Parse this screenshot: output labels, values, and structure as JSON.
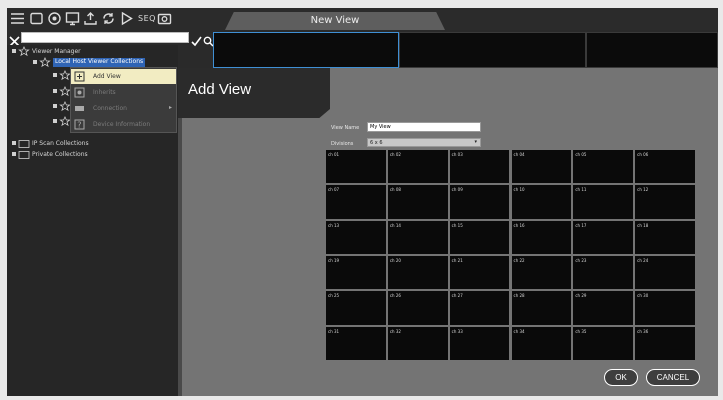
{
  "toolbar": {
    "icons": [
      "menu-icon",
      "window-icon",
      "settings-icon",
      "monitor-icon",
      "upload-icon",
      "sync-icon",
      "play-icon",
      "seq-icon",
      "camera-icon"
    ],
    "seq_label": "SEQ"
  },
  "tab": {
    "label": "New View"
  },
  "search": {
    "value": ""
  },
  "tree": {
    "viewer_manager": "Viewer Manager",
    "selected_collection": "Local Host Viewer Collections",
    "ip_scan": "IP Scan Collections",
    "private": "Private Collections"
  },
  "context_menu": {
    "items": [
      {
        "label": "Add View",
        "icon": "add-view-icon"
      },
      {
        "label": "Inherits",
        "icon": "inherits-icon"
      },
      {
        "label": "Connection",
        "icon": "connection-icon"
      },
      {
        "label": "Device Information",
        "icon": "question-icon"
      }
    ]
  },
  "dialog": {
    "title": "Add View",
    "name_label": "View Name",
    "name_value": "My View",
    "layout_label": "Divisions",
    "layout_value": "6 x 6",
    "ok_label": "OK",
    "cancel_label": "CANCEL"
  },
  "grid": {
    "cells": [
      "ch 01",
      "ch 02",
      "ch 03",
      "ch 04",
      "ch 05",
      "ch 06",
      "ch 07",
      "ch 08",
      "ch 09",
      "ch 10",
      "ch 11",
      "ch 12",
      "ch 13",
      "ch 14",
      "ch 15",
      "ch 16",
      "ch 17",
      "ch 18",
      "ch 19",
      "ch 20",
      "ch 21",
      "ch 22",
      "ch 23",
      "ch 24",
      "ch 25",
      "ch 26",
      "ch 27",
      "ch 28",
      "ch 29",
      "ch 30",
      "ch 31",
      "ch 32",
      "ch 33",
      "ch 34",
      "ch 35",
      "ch 36"
    ]
  },
  "colors": {
    "selection": "#2f64b5",
    "menu_highlight": "#f2ecc2",
    "panel": "#747474"
  }
}
